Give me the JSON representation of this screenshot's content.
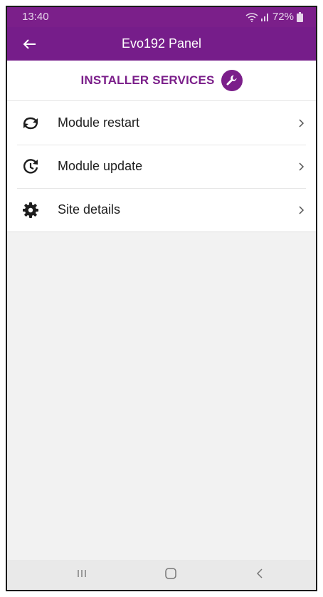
{
  "status_bar": {
    "time": "13:40",
    "battery": "72%",
    "icons": [
      "wifi-icon",
      "signal-icon",
      "battery-icon"
    ]
  },
  "app_bar": {
    "title": "Evo192 Panel",
    "back_icon": "arrow-left-icon"
  },
  "section": {
    "title": "INSTALLER SERVICES",
    "icon": "wrench-icon"
  },
  "menu": {
    "items": [
      {
        "label": "Module restart",
        "icon": "restart-icon"
      },
      {
        "label": "Module update",
        "icon": "update-icon"
      },
      {
        "label": "Site details",
        "icon": "gear-icon"
      }
    ]
  },
  "nav_bar": {
    "buttons": [
      "recents-icon",
      "home-icon",
      "back-icon"
    ]
  },
  "colors": {
    "primary": "#761d8a",
    "status_bar": "#7b1f8a",
    "background": "#f2f2f2",
    "text": "#1e1e1e"
  }
}
